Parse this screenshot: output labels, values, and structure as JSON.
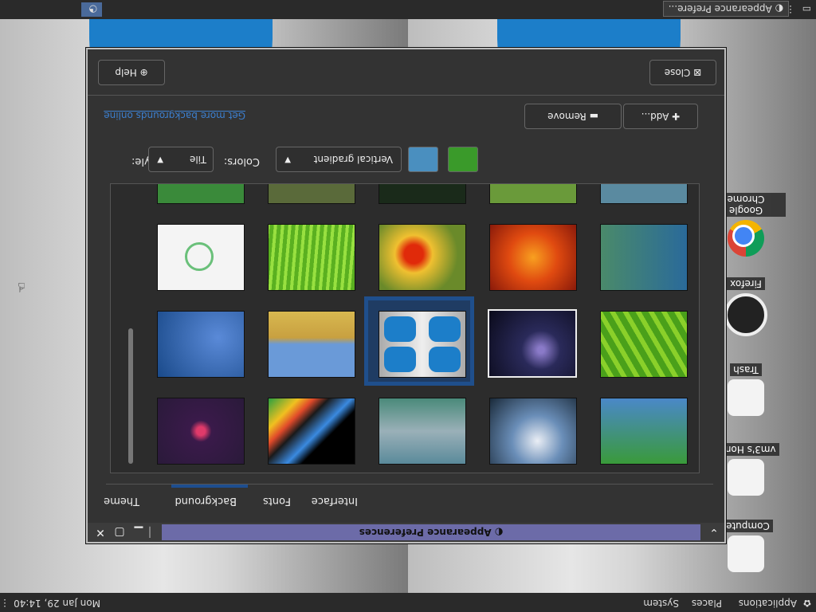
{
  "top_panel": {
    "app_menu": "Applications",
    "places": "Places",
    "system": "System",
    "clock": "Mon Jan 29, 14:40"
  },
  "bottom_panel": {
    "task_label": "Appearance Prefere..."
  },
  "desktop_icons": [
    {
      "label": "Computer"
    },
    {
      "label": "vm3's Home"
    },
    {
      "label": "Trash"
    },
    {
      "label": "Firefox"
    },
    {
      "label": "Google Chrome"
    }
  ],
  "window": {
    "title": "Appearance Preferences",
    "tabs": [
      "Theme",
      "Background",
      "Fonts",
      "Interface"
    ],
    "active_tab": "Background",
    "style_label": "Style:",
    "style_value": "Tile",
    "colors_label": "Colors:",
    "colors_value": "Vertical gradient",
    "color1": "#4a8fbf",
    "color2": "#3a9a2a",
    "link_text": "Get more backgrounds online",
    "remove_label": "Remove",
    "add_label": "Add...",
    "help_label": "Help",
    "close_label": "Close"
  },
  "icons": {
    "close": "close-icon",
    "minimize": "minimize-icon",
    "maximize": "maximize-icon",
    "help": "help-icon",
    "add": "plus-icon",
    "remove": "minus-icon"
  }
}
